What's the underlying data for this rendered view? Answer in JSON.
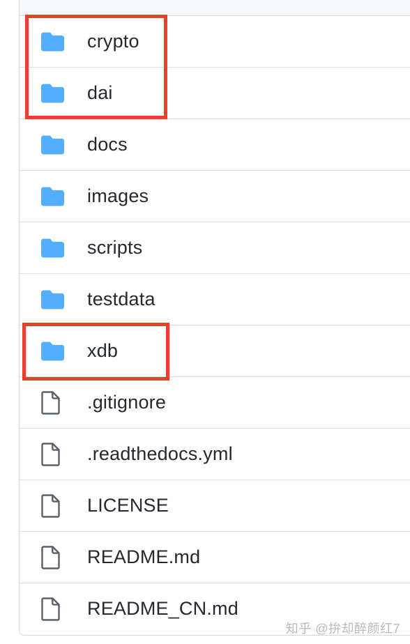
{
  "file_list": {
    "rows": [
      {
        "name": "crypto",
        "type": "folder",
        "icon": "folder-icon"
      },
      {
        "name": "dai",
        "type": "folder",
        "icon": "folder-icon"
      },
      {
        "name": "docs",
        "type": "folder",
        "icon": "folder-icon"
      },
      {
        "name": "images",
        "type": "folder",
        "icon": "folder-icon"
      },
      {
        "name": "scripts",
        "type": "folder",
        "icon": "folder-icon"
      },
      {
        "name": "testdata",
        "type": "folder",
        "icon": "folder-icon"
      },
      {
        "name": "xdb",
        "type": "folder",
        "icon": "folder-icon"
      },
      {
        "name": ".gitignore",
        "type": "file",
        "icon": "file-icon"
      },
      {
        "name": ".readthedocs.yml",
        "type": "file",
        "icon": "file-icon"
      },
      {
        "name": "LICENSE",
        "type": "file",
        "icon": "file-icon"
      },
      {
        "name": "README.md",
        "type": "file",
        "icon": "file-icon"
      },
      {
        "name": "README_CN.md",
        "type": "file",
        "icon": "file-icon"
      }
    ]
  },
  "annotations": {
    "highlight_color": "#e8402a",
    "highlighted_rows": [
      "crypto",
      "dai",
      "xdb"
    ]
  },
  "colors": {
    "folder": "#54aeff",
    "file": "#57606a",
    "text": "#24292f",
    "border": "#d8dee4"
  },
  "watermark": {
    "text": "知乎 @拚却醉颜红7"
  }
}
